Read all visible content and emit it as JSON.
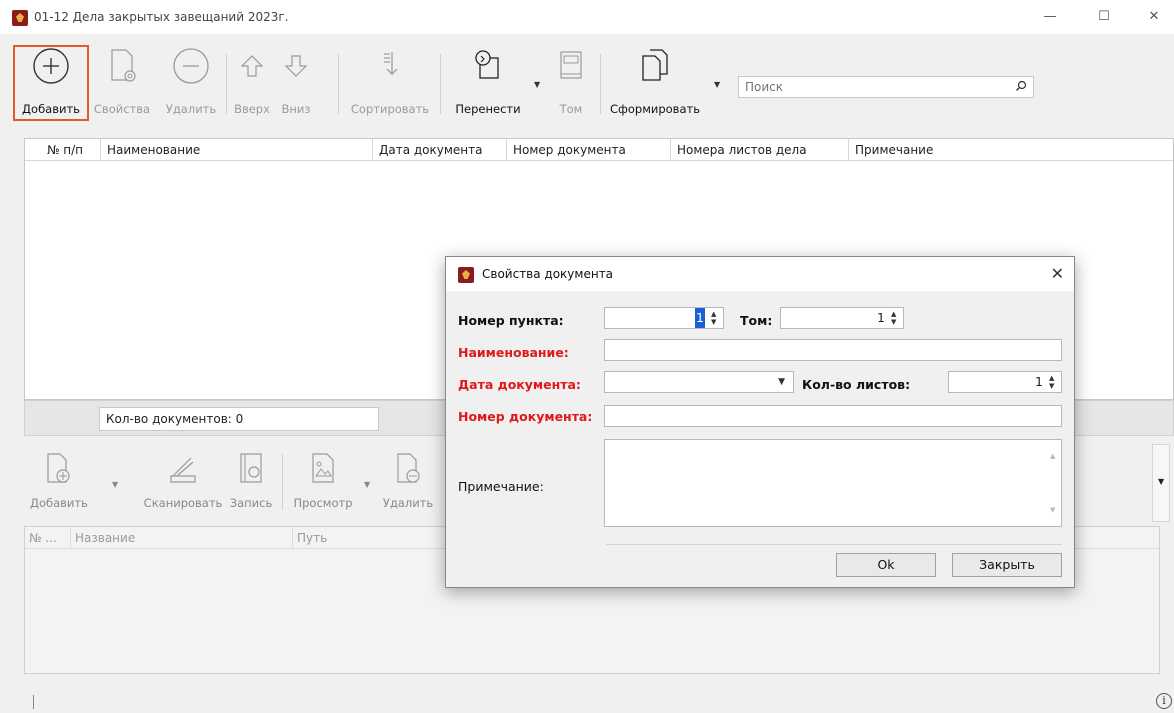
{
  "window": {
    "title": "01-12 Дела закрытых завещаний 2023г.",
    "minimize": "—",
    "maximize": "☐",
    "close": "✕"
  },
  "toolbar": {
    "add": "Добавить",
    "properties": "Свойства",
    "delete": "Удалить",
    "up": "Вверх",
    "down": "Вниз",
    "sort": "Сортировать",
    "move": "Перенести",
    "volume": "Том",
    "generate": "Сформировать",
    "search_placeholder": "Поиск"
  },
  "table": {
    "columns": [
      "№ п/п",
      "Наименование",
      "Дата документа",
      "Номер документа",
      "Номера листов дела",
      "Примечание"
    ],
    "rows": []
  },
  "status": {
    "doc_count": "Кол-во документов: 0"
  },
  "lower_toolbar": {
    "add": "Добавить",
    "scan": "Сканировать",
    "record": "Запись",
    "view": "Просмотр",
    "delete": "Удалить"
  },
  "lower_table": {
    "columns": [
      "№ ...",
      "Название",
      "Путь"
    ]
  },
  "dialog": {
    "title": "Свойства документа",
    "close": "✕",
    "item_number_label": "Номер пункта:",
    "item_number_value": "1",
    "volume_label": "Том:",
    "volume_value": "1",
    "name_label": "Наименование:",
    "name_value": "",
    "date_label": "Дата документа:",
    "date_value": "",
    "sheets_label": "Кол-во листов:",
    "sheets_value": "1",
    "doc_number_label": "Номер документа:",
    "doc_number_value": "",
    "note_label": "Примечание:",
    "note_value": "",
    "ok": "Ok",
    "close_btn": "Закрыть"
  },
  "status_bar": {
    "info_icon": "i"
  },
  "colors": {
    "required_label": "#e01818",
    "highlight_border": "#e05a2a",
    "selection": "#1a5fd6"
  }
}
